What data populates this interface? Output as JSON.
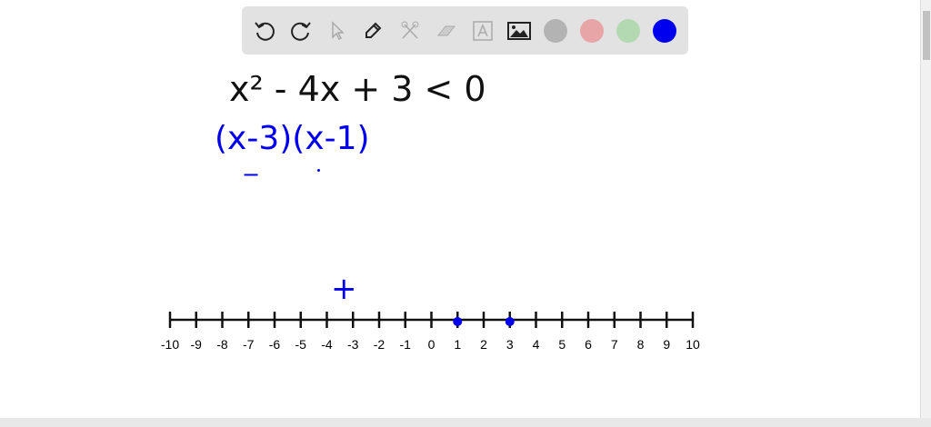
{
  "toolbar": {
    "tools": [
      "undo-icon",
      "redo-icon",
      "select-icon",
      "pen-icon",
      "tools-icon",
      "eraser-icon",
      "text-icon",
      "image-icon"
    ],
    "colors": [
      "#b3b3b3",
      "#e8a5a8",
      "#b3d9b3",
      "#0000ee"
    ]
  },
  "handwriting": {
    "line1": "x² - 4x + 3 < 0",
    "line2": "(x-3)(x-1)",
    "sign_minus": "−",
    "sign_plus": "+"
  },
  "number_line": {
    "min": -10,
    "max": 10,
    "labels": [
      "-10",
      "-9",
      "-8",
      "-7",
      "-6",
      "-5",
      "-4",
      "-3",
      "-2",
      "-1",
      "0",
      "1",
      "2",
      "3",
      "4",
      "5",
      "6",
      "7",
      "8",
      "9",
      "10"
    ],
    "points": [
      1,
      3
    ],
    "plus_at": -3.3
  }
}
